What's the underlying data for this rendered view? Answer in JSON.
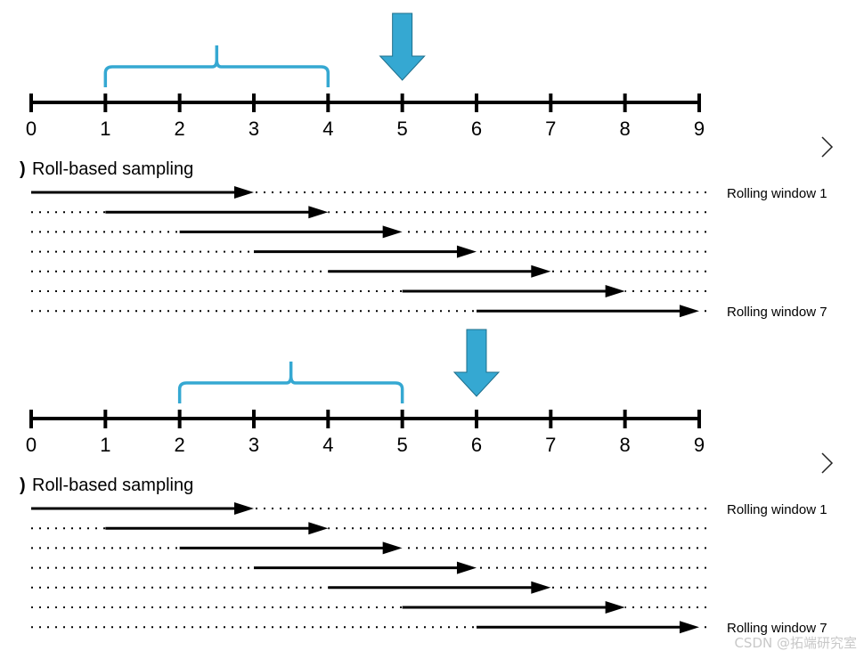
{
  "colors": {
    "accent": "#35a8d2",
    "line": "#000000"
  },
  "panels": [
    {
      "ticks": [
        "0",
        "1",
        "2",
        "3",
        "4",
        "5",
        "6",
        "7",
        "8",
        "9"
      ],
      "window": [
        1,
        4
      ],
      "target": 5,
      "title": "Roll-based sampling",
      "title_prefix": ")",
      "rows": [
        [
          0,
          3
        ],
        [
          1,
          4
        ],
        [
          2,
          5
        ],
        [
          3,
          6
        ],
        [
          4,
          7
        ],
        [
          5,
          8
        ],
        [
          6,
          9
        ]
      ],
      "first_label": "Rolling window 1",
      "last_label": "Rolling window 7"
    },
    {
      "ticks": [
        "0",
        "1",
        "2",
        "3",
        "4",
        "5",
        "6",
        "7",
        "8",
        "9"
      ],
      "window": [
        2,
        5
      ],
      "target": 6,
      "title": "Roll-based sampling",
      "title_prefix": ")",
      "rows": [
        [
          0,
          3
        ],
        [
          1,
          4
        ],
        [
          2,
          5
        ],
        [
          3,
          6
        ],
        [
          4,
          7
        ],
        [
          5,
          8
        ],
        [
          6,
          9
        ]
      ],
      "first_label": "Rolling window 1",
      "last_label": "Rolling window 7"
    }
  ],
  "nav_icon": "chevron-right-icon",
  "watermark": "CSDN @拓端研究室"
}
